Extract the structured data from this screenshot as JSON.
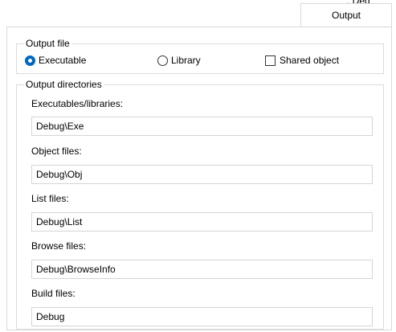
{
  "tabs": {
    "clipped_label": ", Deg",
    "active_label": "Output"
  },
  "output_file": {
    "legend": "Output file",
    "executable_label": "Executable",
    "library_label": "Library",
    "shared_object_label": "Shared object",
    "selected": "Executable"
  },
  "output_directories": {
    "legend": "Output directories",
    "executables": {
      "label": "Executables/libraries:",
      "value": "Debug\\Exe"
    },
    "object_files": {
      "label": "Object files:",
      "value": "Debug\\Obj"
    },
    "list_files": {
      "label": "List files:",
      "value": "Debug\\List"
    },
    "browse_files": {
      "label": "Browse files:",
      "value": "Debug\\BrowseInfo"
    },
    "build_files": {
      "label": "Build files:",
      "value": "Debug"
    }
  },
  "colors": {
    "radio_selected": "#0067c0",
    "border": "#d9d9d9"
  }
}
